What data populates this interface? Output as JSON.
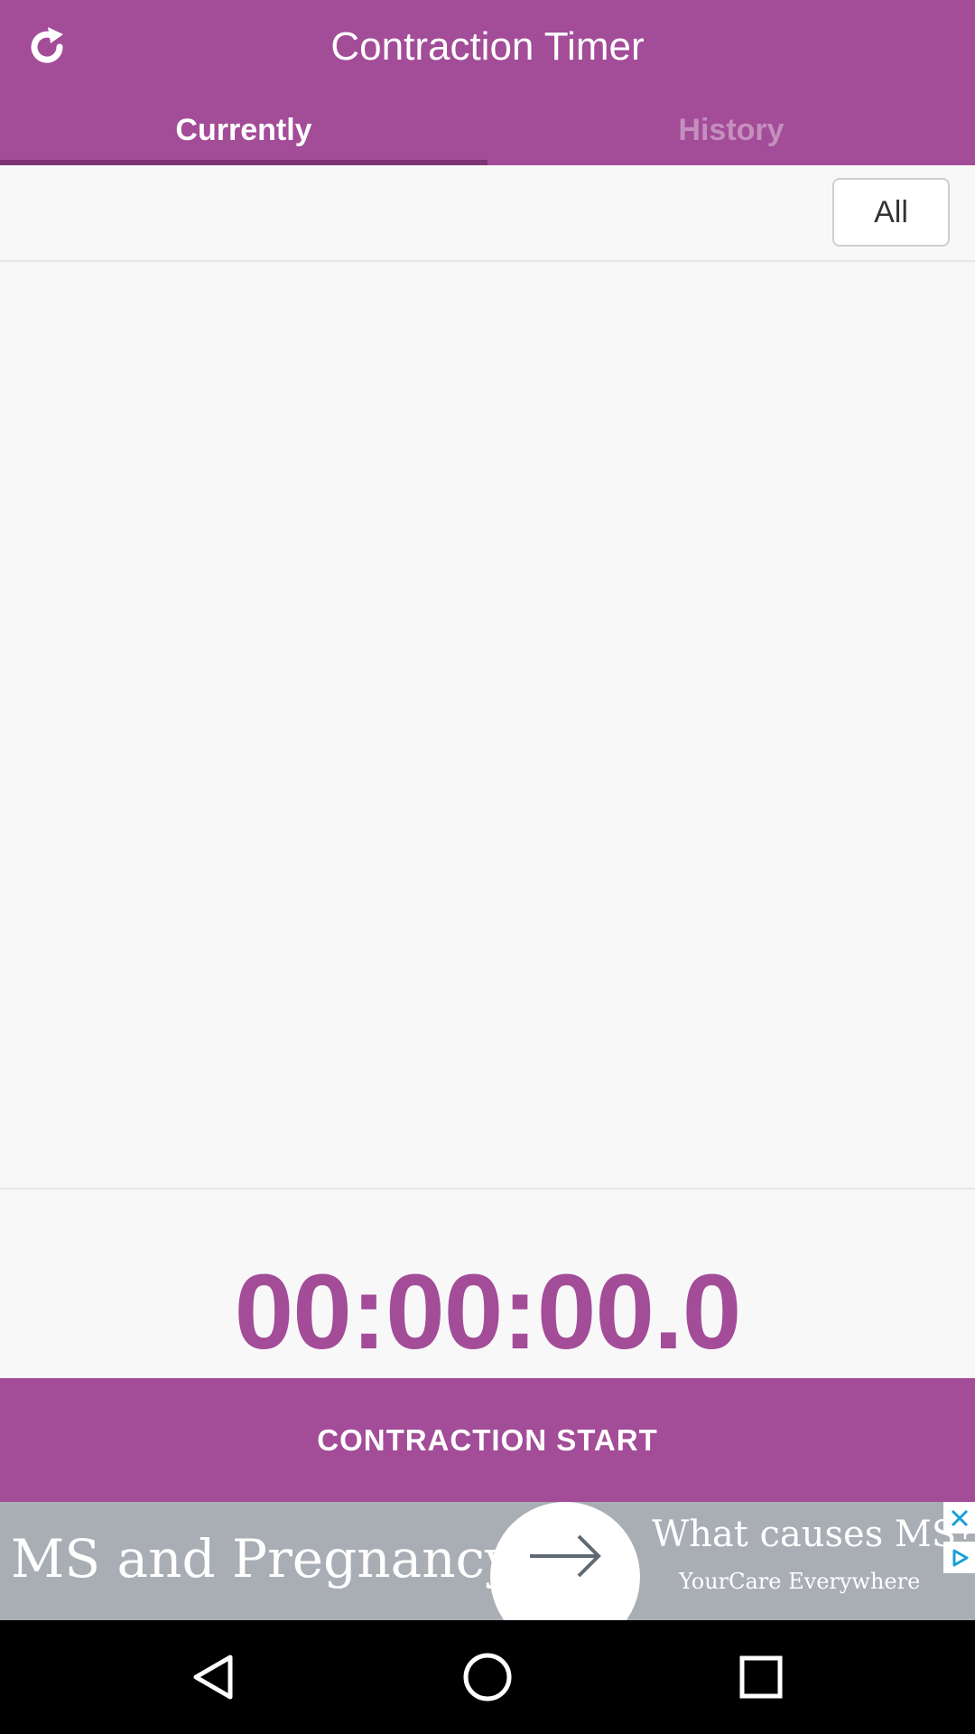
{
  "app": {
    "title": "Contraction Timer"
  },
  "tabs": {
    "currently_label": "Currently",
    "history_label": "History",
    "active": "Currently"
  },
  "filter": {
    "all_label": "All"
  },
  "timer": {
    "value": "00:00:00.0"
  },
  "actions": {
    "start_label": "CONTRACTION START"
  },
  "ad": {
    "left_text": "MS and Pregnancy",
    "right_title": "What causes MS?",
    "right_subtitle": "YourCare Everywhere"
  },
  "icons": {
    "refresh": "refresh-icon",
    "ad_arrow": "arrow-right-icon",
    "ad_close": "close-icon",
    "ad_choices": "ad-choices-icon",
    "nav_back": "back-icon",
    "nav_home": "home-icon",
    "nav_recent": "recent-apps-icon"
  },
  "colors": {
    "brand": "#a34c98",
    "tab_inactive": "#c48fbd",
    "tab_indicator": "#7d3474",
    "background": "#f8f8f8",
    "ad_background": "#a9aeb5"
  }
}
